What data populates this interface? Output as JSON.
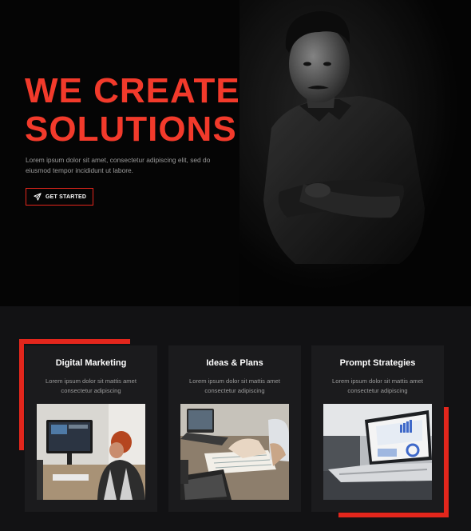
{
  "hero": {
    "title_line1": "WE CREATE",
    "title_line2": "SOLUTIONS",
    "description": "Lorem ipsum dolor sit amet, consectetur adipiscing elit, sed do eiusmod tempor incididunt ut labore.",
    "cta_label": "GET STARTED",
    "cta_icon": "paper-plane-icon"
  },
  "colors": {
    "accent": "#F23A2B",
    "background": "#050505",
    "section_background": "#121214",
    "card_background": "#1B1B1D"
  },
  "services": [
    {
      "title": "Digital Marketing",
      "description": "Lorem ipsum dolor sit mattis amet consectetur adipiscing"
    },
    {
      "title": "Ideas & Plans",
      "description": "Lorem ipsum dolor sit mattis amet consectetur adipiscing"
    },
    {
      "title": "Prompt Strategies",
      "description": "Lorem ipsum dolor sit mattis amet consectetur adipiscing"
    }
  ]
}
